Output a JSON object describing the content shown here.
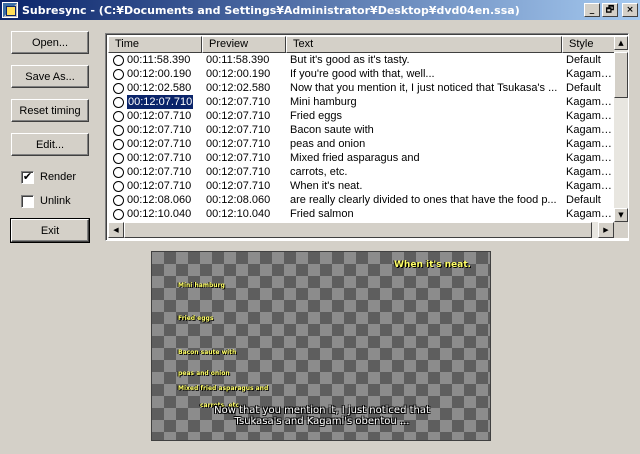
{
  "window": {
    "title": "Subresync - (C:¥Documents and Settings¥Administrator¥Desktop¥dvd04en.ssa)",
    "minimize_glyph": "_",
    "maximize_glyph": "🗗",
    "close_glyph": "×"
  },
  "buttons": {
    "open": "Open...",
    "save_as": "Save As...",
    "reset_timing": "Reset timing",
    "edit": "Edit...",
    "exit": "Exit"
  },
  "options": {
    "render": {
      "label": "Render",
      "checked": true
    },
    "unlink": {
      "label": "Unlink",
      "checked": false
    }
  },
  "list": {
    "columns": [
      "Time",
      "Preview",
      "Text",
      "Style"
    ],
    "rows": [
      {
        "time": "00:11:58.390",
        "preview": "00:11:58.390",
        "text": "But it's good as it's tasty.",
        "style": "Default"
      },
      {
        "time": "00:12:00.190",
        "preview": "00:12:00.190",
        "text": "If you're good with that, well...",
        "style": "KagamiT..."
      },
      {
        "time": "00:12:02.580",
        "preview": "00:12:02.580",
        "text": "Now that you mention it, I just noticed that Tsukasa's ...",
        "style": "Default"
      },
      {
        "time": "00:12:07.710",
        "preview": "00:12:07.710",
        "text": "Mini hamburg",
        "style": "KagamiT..."
      },
      {
        "time": "00:12:07.710",
        "preview": "00:12:07.710",
        "text": "Fried eggs",
        "style": "KagamiT..."
      },
      {
        "time": "00:12:07.710",
        "preview": "00:12:07.710",
        "text": "Bacon saute with",
        "style": "KagamiT..."
      },
      {
        "time": "00:12:07.710",
        "preview": "00:12:07.710",
        "text": "peas and onion",
        "style": "KagamiT..."
      },
      {
        "time": "00:12:07.710",
        "preview": "00:12:07.710",
        "text": "Mixed fried asparagus and",
        "style": "KagamiT..."
      },
      {
        "time": "00:12:07.710",
        "preview": "00:12:07.710",
        "text": "carrots, etc.",
        "style": "KagamiT..."
      },
      {
        "time": "00:12:07.710",
        "preview": "00:12:07.710",
        "text": "When it's neat.",
        "style": "KagamiT..."
      },
      {
        "time": "00:12:08.060",
        "preview": "00:12:08.060",
        "text": "are really clearly divided to ones that have the food p...",
        "style": "Default"
      },
      {
        "time": "00:12:10.040",
        "preview": "00:12:10.040",
        "text": "Fried salmon",
        "style": "KagamiT..."
      }
    ],
    "selected_index": 3
  },
  "preview": {
    "top_line": "When it's neat.",
    "side_lines": [
      "Mini hamburg",
      "Fried eggs",
      "Bacon saute with",
      "peas and onion",
      "Mixed fried asparagus and",
      "carrots, etc."
    ],
    "main_lines": [
      "Now that you mention it, I just noticed that",
      "Tsukasa's and Kagami's obentou ..."
    ]
  },
  "scrollbars": {
    "up": "▲",
    "down": "▼",
    "left": "◀",
    "right": "▶"
  }
}
